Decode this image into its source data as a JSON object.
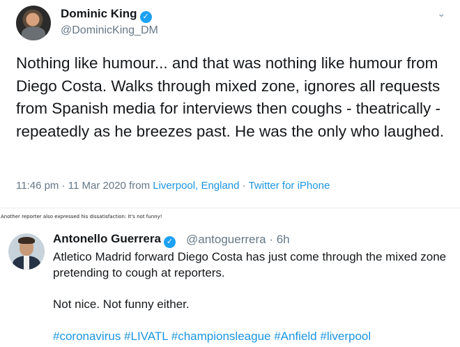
{
  "tweet1": {
    "name": "Dominic King",
    "handle": "@DominicKing_DM",
    "text": "Nothing like humour... and that was nothing like humour from Diego Costa. Walks through mixed zone, ignores all requests from Spanish media for interviews then coughs - theatrically - repeatedly as he breezes past. He was the only who laughed.",
    "time": "11:46 pm",
    "date": "11 Mar 2020",
    "from_label": "from",
    "location": "Liverpool, England",
    "source": "Twitter for iPhone",
    "sep": "·"
  },
  "caption": "Another reporter also expressed his dissatisfaction: It's not funny!",
  "tweet2": {
    "name": "Antonello Guerrera",
    "handle": "@antoguerrera",
    "age": "· 6h",
    "text_line1": "Atletico Madrid forward Diego Costa has just come through the mixed zone pretending to cough at reporters.",
    "text_line2": "Not nice. Not funny either.",
    "hashtags": "#coronavirus #LIVATL #championsleague #Anfield #liverpool"
  },
  "icons": {
    "verified": "✓",
    "chevron": "⌄"
  },
  "colors": {
    "link": "#1b95e0",
    "verified": "#1da1f2",
    "muted": "#657786"
  }
}
